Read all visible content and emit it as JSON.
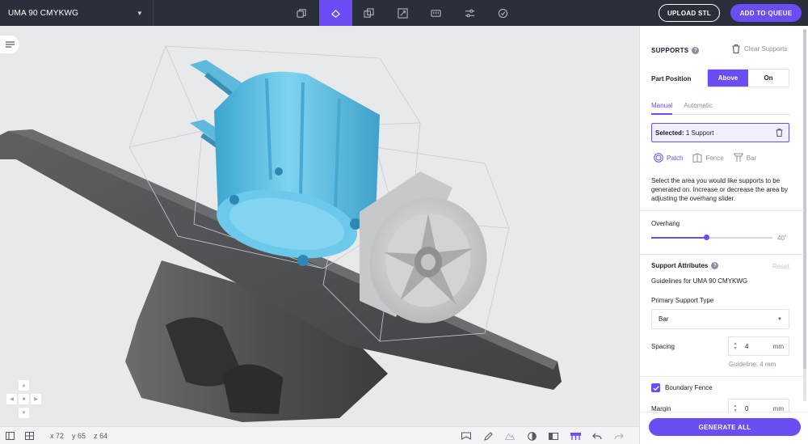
{
  "topbar": {
    "printer_name": "UMA 90 CMYKWG",
    "tools": [
      {
        "icon": "layers-icon",
        "active": false
      },
      {
        "icon": "orient-icon",
        "active": true
      },
      {
        "icon": "duplicate-icon",
        "active": false
      },
      {
        "icon": "scale-icon",
        "active": false
      },
      {
        "icon": "measure-icon",
        "active": false
      },
      {
        "icon": "settings-sliders-icon",
        "active": false
      },
      {
        "icon": "check-icon",
        "active": false
      }
    ],
    "upload_label": "UPLOAD STL",
    "queue_label": "ADD TO QUEUE"
  },
  "bottombar": {
    "x_label": "x",
    "x_value": "72",
    "y_label": "y",
    "y_value": "65",
    "z_label": "z",
    "z_value": "64"
  },
  "panel": {
    "title": "SUPPORTS",
    "clear_label": "Clear Supports",
    "part_position_label": "Part Position",
    "position_options": [
      "Above",
      "On"
    ],
    "position_selected": "Above",
    "tabs": [
      "Manual",
      "Automatic"
    ],
    "active_tab": "Manual",
    "selected_label": "Selected:",
    "selected_value": "1 Support",
    "modes": [
      "Patch",
      "Fence",
      "Bar"
    ],
    "active_mode": "Patch",
    "description": "Select the area you would like supports to be generated on. Increase or decrease the area by adjusting the overhang slider.",
    "overhang_label": "Overhang",
    "overhang_value": "40˚",
    "overhang_fraction": 0.45,
    "attributes_title": "Support Attributes",
    "reset_label": "Reset",
    "guidelines_text": "Guidelines for UMA 90 CMYKWG",
    "primary_type_label": "Primary Support Type",
    "primary_type_value": "Bar",
    "spacing_label": "Spacing",
    "spacing_value": "4",
    "spacing_unit": "mm",
    "spacing_guideline": "Guideline: 4 mm",
    "boundary_fence_label": "Boundary Fence",
    "boundary_fence_checked": true,
    "margin_label": "Margin",
    "margin_value": "0",
    "margin_unit": "mm",
    "generate_label": "GENERATE ALL"
  },
  "colors": {
    "accent": "#6c4cf5",
    "topbar": "#2b2f3a",
    "part_selected": "#5ec3e6",
    "part_unselected": "#c9cbce",
    "build_plate": "#55575b"
  }
}
